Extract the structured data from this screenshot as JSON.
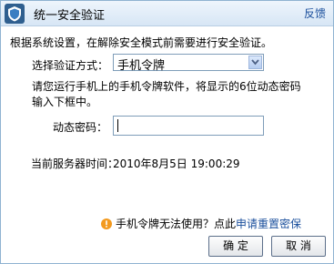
{
  "titlebar": {
    "title": "统一安全验证",
    "feedback": "反馈"
  },
  "intro": "根据系统设置，在解除安全模式前需要进行安全验证。",
  "method": {
    "label": "选择验证方式：",
    "selected": "手机令牌"
  },
  "info": "请您运行手机上的手机令牌软件，将显示的6位动态密码输入下框中。",
  "code": {
    "label": "动态密码：",
    "value": ""
  },
  "server_time": {
    "label": "当前服务器时间：",
    "value": "2010年8月5日  19:00:29"
  },
  "help": {
    "text": "手机令牌无法使用？点此",
    "link": "申请重置密保"
  },
  "buttons": {
    "ok": "确 定",
    "cancel": "取 消"
  },
  "icons": {
    "shield": "shield-icon",
    "dropdown": "chevron-down-icon",
    "warning": "warning-icon"
  },
  "colors": {
    "link": "#1a4f9c",
    "warning": "#f39a1e"
  }
}
